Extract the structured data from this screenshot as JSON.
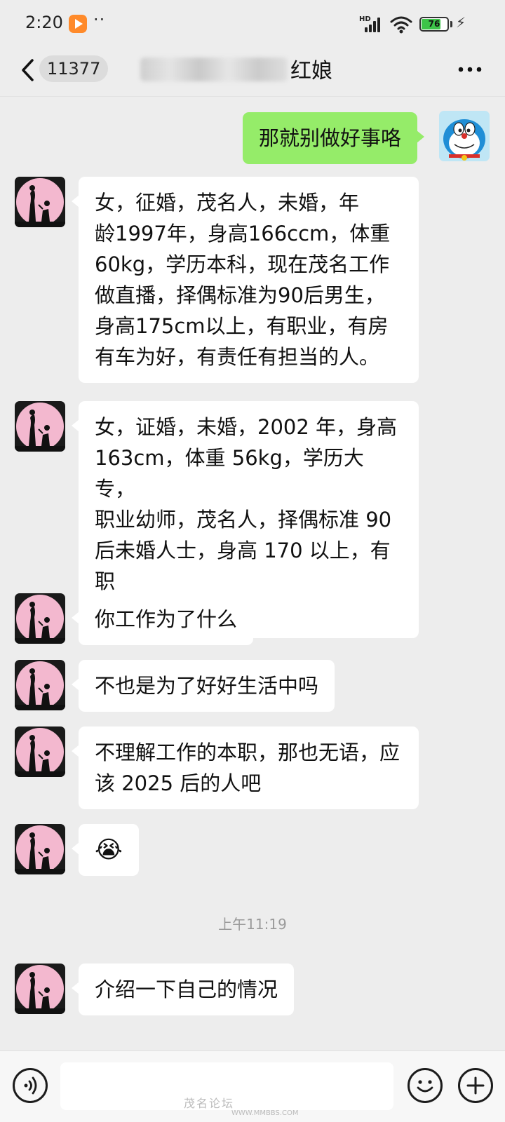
{
  "status_bar": {
    "time": "2:20",
    "dots": "··",
    "network_label": "HD",
    "battery_percent": "76",
    "battery_level": 0.76
  },
  "header": {
    "unread_count": "11377",
    "title_visible_suffix": "红娘"
  },
  "messages": [
    {
      "side": "me",
      "text": "那就别做好事咯"
    },
    {
      "side": "them",
      "text": "女，征婚，茂名人，未婚，年\n龄1997年，身高166ccm，体重\n60kg，学历本科，现在茂名工作\n做直播，择偶标准为90后男生，\n身高175cm以上，有职业，有房\n有车为好，有责任有担当的人。"
    },
    {
      "side": "them",
      "text": "女，证婚，未婚，2002 年，身高\n163cm，体重 56kg，学历大专，\n职业幼师，茂名人，择偶标准 90\n后未婚人士，身高 170 以上，有职\n业，有眼缘的人。"
    },
    {
      "side": "them",
      "text": "你工作为了什么"
    },
    {
      "side": "them",
      "text": "不也是为了好好生活中吗"
    },
    {
      "side": "them",
      "text": "不理解工作的本职，那也无语，应\n该 2025 后的人吧"
    },
    {
      "side": "them",
      "text": "😭"
    },
    {
      "side": "them",
      "text": "介绍一下自己的情况"
    }
  ],
  "time_divider": "上午11:19",
  "input": {
    "value": "",
    "placeholder": ""
  },
  "watermark": {
    "text": "茂名论坛",
    "sub": "WWW.MMBBS.COM"
  },
  "colors": {
    "background": "#ededed",
    "my_bubble": "#95ec69",
    "their_bubble": "#ffffff",
    "avatar_pink": "#f3b8cf"
  },
  "icons": [
    "back-arrow-icon",
    "more-icon",
    "voice-icon",
    "emoji-icon",
    "plus-icon",
    "signal-icon",
    "wifi-icon",
    "battery-icon"
  ]
}
